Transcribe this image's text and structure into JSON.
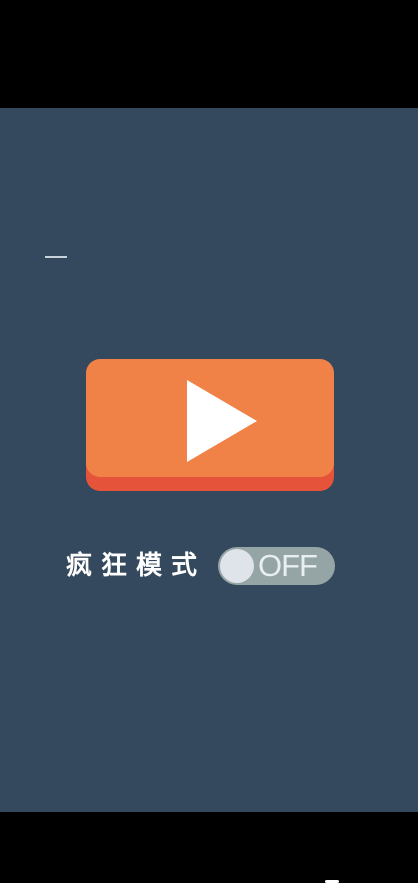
{
  "game": {
    "crazy_mode_label": "疯狂模式",
    "toggle_state_label": "OFF",
    "toggle_on": false
  },
  "icons": {
    "play": "play-icon",
    "dash": "dash-mark"
  },
  "colors": {
    "background": "#34495e",
    "button_face": "#f08147",
    "button_shadow": "#e5533a",
    "toggle_track": "#95a5a6",
    "toggle_knob": "#dfe4ea",
    "letterbox": "#000000"
  }
}
